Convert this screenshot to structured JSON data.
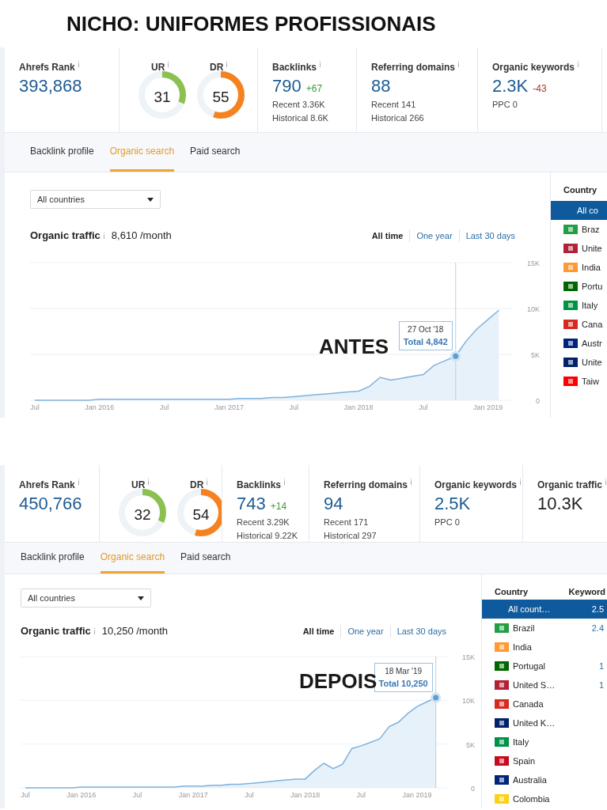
{
  "title": "NICHO: UNIFORMES PROFISSIONAIS",
  "sections": [
    {
      "overlay_label": "ANTES",
      "metrics": [
        {
          "kind": "rank",
          "label": "Ahrefs Rank",
          "value": "393,868"
        },
        {
          "kind": "gauges",
          "gauges": [
            {
              "label": "UR",
              "value": "31",
              "level": 0.31,
              "color": "#8cc152"
            },
            {
              "label": "DR",
              "value": "55",
              "level": 0.55,
              "color": "#f5821f"
            }
          ]
        },
        {
          "kind": "stat",
          "label": "Backlinks",
          "value": "790",
          "change": "+67",
          "color": "#3c9a3c",
          "lines": [
            "Recent 3.36K",
            "Historical 8.6K"
          ]
        },
        {
          "kind": "stat",
          "label": "Referring domains",
          "value": "88",
          "lines": [
            "Recent 141",
            "Historical 266"
          ]
        },
        {
          "kind": "stat",
          "label": "Organic keywords",
          "value": "2.3K",
          "change": "-43",
          "color": "#a33a2a",
          "lines": [
            "PPC 0"
          ]
        }
      ],
      "tabs": [
        {
          "label": "Backlink profile",
          "selected": false
        },
        {
          "label": "Organic search",
          "selected": true
        },
        {
          "label": "Paid search",
          "selected": false
        }
      ],
      "dropdown": {
        "value": "All countries"
      },
      "traffic": {
        "label": "Organic traffic",
        "value": "8,610 /month"
      },
      "ranges": [
        {
          "label": "All time",
          "selected": true
        },
        {
          "label": "One year",
          "selected": false
        },
        {
          "label": "Last 30 days",
          "selected": false
        }
      ],
      "tooltip": {
        "date": "27 Oct '18"
      },
      "chart_data": {
        "type": "area",
        "categories": [
          "Jul",
          null,
          null,
          null,
          null,
          null,
          "Jan 2016",
          null,
          null,
          null,
          null,
          null,
          "Jul",
          null,
          null,
          null,
          null,
          null,
          "Jan 2017",
          null,
          null,
          null,
          null,
          null,
          "Jul",
          null,
          null,
          null,
          null,
          null,
          "Jan 2018",
          null,
          null,
          null,
          null,
          null,
          "Jul",
          null,
          null,
          null,
          null,
          null,
          "Jan 2019",
          null
        ],
        "series": [
          {
            "color": "#7fb2dc",
            "values": [
              0,
              0,
              0,
              0,
              0,
              0,
              100,
              100,
              100,
              100,
              100,
              100,
              100,
              100,
              100,
              100,
              100,
              100,
              100,
              200,
              200,
              200,
              300,
              300,
              400,
              500,
              600,
              700,
              800,
              900,
              1000,
              1500,
              2500,
              2200,
              2400,
              2600,
              2800,
              3800,
              4300,
              4800,
              6500,
              7800,
              8800,
              9800
            ]
          }
        ],
        "ylim": [
          0,
          15000
        ],
        "yticks": [
          {
            "value": 0,
            "label": "0"
          },
          {
            "value": 5000,
            "label": "5K"
          },
          {
            "value": 10000,
            "label": "10K"
          },
          {
            "value": 15000,
            "label": "15K"
          }
        ],
        "annotations": [
          "Total 4,842"
        ]
      },
      "countries": {
        "columns": [
          "Country"
        ],
        "rows": [
          {
            "name": "All co",
            "selected": true
          },
          {
            "name": "Braz",
            "color": "#229e45",
            "selected": false
          },
          {
            "name": "Unite",
            "color": "#b22234",
            "selected": false
          },
          {
            "name": "India",
            "color": "#ff9933",
            "selected": false
          },
          {
            "name": "Portu",
            "color": "#006600",
            "selected": false
          },
          {
            "name": "Italy",
            "color": "#009246",
            "selected": false
          },
          {
            "name": "Cana",
            "color": "#d52b1e",
            "selected": false
          },
          {
            "name": "Austr",
            "color": "#00247d",
            "selected": false
          },
          {
            "name": "Unite",
            "color": "#012169",
            "selected": false
          },
          {
            "name": "Taiw",
            "color": "#fe0000",
            "selected": false
          }
        ]
      }
    },
    {
      "overlay_label": "DEPOIS",
      "metrics": [
        {
          "kind": "rank",
          "label": "Ahrefs Rank",
          "value": "450,766"
        },
        {
          "kind": "gauges",
          "gauges": [
            {
              "label": "UR",
              "value": "32",
              "level": 0.32,
              "color": "#8cc152"
            },
            {
              "label": "DR",
              "value": "54",
              "level": 0.54,
              "color": "#f5821f"
            }
          ]
        },
        {
          "kind": "stat",
          "label": "Backlinks",
          "value": "743",
          "change": "+14",
          "color": "#3c9a3c",
          "lines": [
            "Recent 3.29K",
            "Historical 9.22K"
          ]
        },
        {
          "kind": "stat",
          "label": "Referring domains",
          "value": "94",
          "lines": [
            "Recent 171",
            "Historical 297"
          ]
        },
        {
          "kind": "stat",
          "label": "Organic keywords",
          "value": "2.5K",
          "lines": [
            "PPC 0"
          ]
        },
        {
          "kind": "traffic",
          "label": "Organic traffic",
          "value": "10.3K"
        }
      ],
      "tabs": [
        {
          "label": "Backlink profile",
          "selected": false
        },
        {
          "label": "Organic search",
          "selected": true
        },
        {
          "label": "Paid search",
          "selected": false
        }
      ],
      "dropdown": {
        "value": "All countries"
      },
      "traffic": {
        "label": "Organic traffic",
        "value": "10,250 /month"
      },
      "ranges": [
        {
          "label": "All time",
          "selected": true
        },
        {
          "label": "One year",
          "selected": false
        },
        {
          "label": "Last 30 days",
          "selected": false
        }
      ],
      "tooltip": {
        "date": "18 Mar '19"
      },
      "chart_data": {
        "type": "area",
        "categories": [
          "Jul",
          null,
          null,
          null,
          null,
          null,
          "Jan 2016",
          null,
          null,
          null,
          null,
          null,
          "Jul",
          null,
          null,
          null,
          null,
          null,
          "Jan 2017",
          null,
          null,
          null,
          null,
          null,
          "Jul",
          null,
          null,
          null,
          null,
          null,
          "Jan 2018",
          null,
          null,
          null,
          null,
          null,
          "Jul",
          null,
          null,
          null,
          null,
          null,
          "Jan 2019",
          null,
          null
        ],
        "series": [
          {
            "color": "#7fb2dc",
            "values": [
              0,
              0,
              0,
              0,
              0,
              0,
              100,
              100,
              100,
              100,
              100,
              100,
              100,
              100,
              100,
              100,
              100,
              200,
              200,
              200,
              300,
              300,
              400,
              400,
              500,
              600,
              700,
              800,
              900,
              1000,
              1000,
              2000,
              2800,
              2200,
              2700,
              4500,
              4800,
              5200,
              5600,
              7000,
              7500,
              8500,
              9300,
              9800,
              10300
            ]
          }
        ],
        "ylim": [
          0,
          15000
        ],
        "yticks": [
          {
            "value": 0,
            "label": "0"
          },
          {
            "value": 5000,
            "label": "5K"
          },
          {
            "value": 10000,
            "label": "10K"
          },
          {
            "value": 15000,
            "label": "15K"
          }
        ],
        "annotations": [
          "Total 10,250"
        ]
      },
      "countries": {
        "columns": [
          "Country",
          "Keyword"
        ],
        "rows": [
          {
            "name": "All count…",
            "keywords": "2.5",
            "selected": true
          },
          {
            "name": "Brazil",
            "keywords": "2.4",
            "color": "#229e45",
            "selected": false
          },
          {
            "name": "India",
            "color": "#ff9933",
            "selected": false
          },
          {
            "name": "Portugal",
            "keywords": "1",
            "color": "#006600",
            "selected": false
          },
          {
            "name": "United S…",
            "keywords": "1",
            "color": "#b22234",
            "selected": false
          },
          {
            "name": "Canada",
            "color": "#d52b1e",
            "selected": false
          },
          {
            "name": "United K…",
            "color": "#012169",
            "selected": false
          },
          {
            "name": "Italy",
            "color": "#009246",
            "selected": false
          },
          {
            "name": "Spain",
            "color": "#c60b1e",
            "selected": false
          },
          {
            "name": "Australia",
            "color": "#00247d",
            "selected": false
          },
          {
            "name": "Colombia",
            "color": "#fcd116",
            "selected": false
          }
        ]
      }
    }
  ]
}
